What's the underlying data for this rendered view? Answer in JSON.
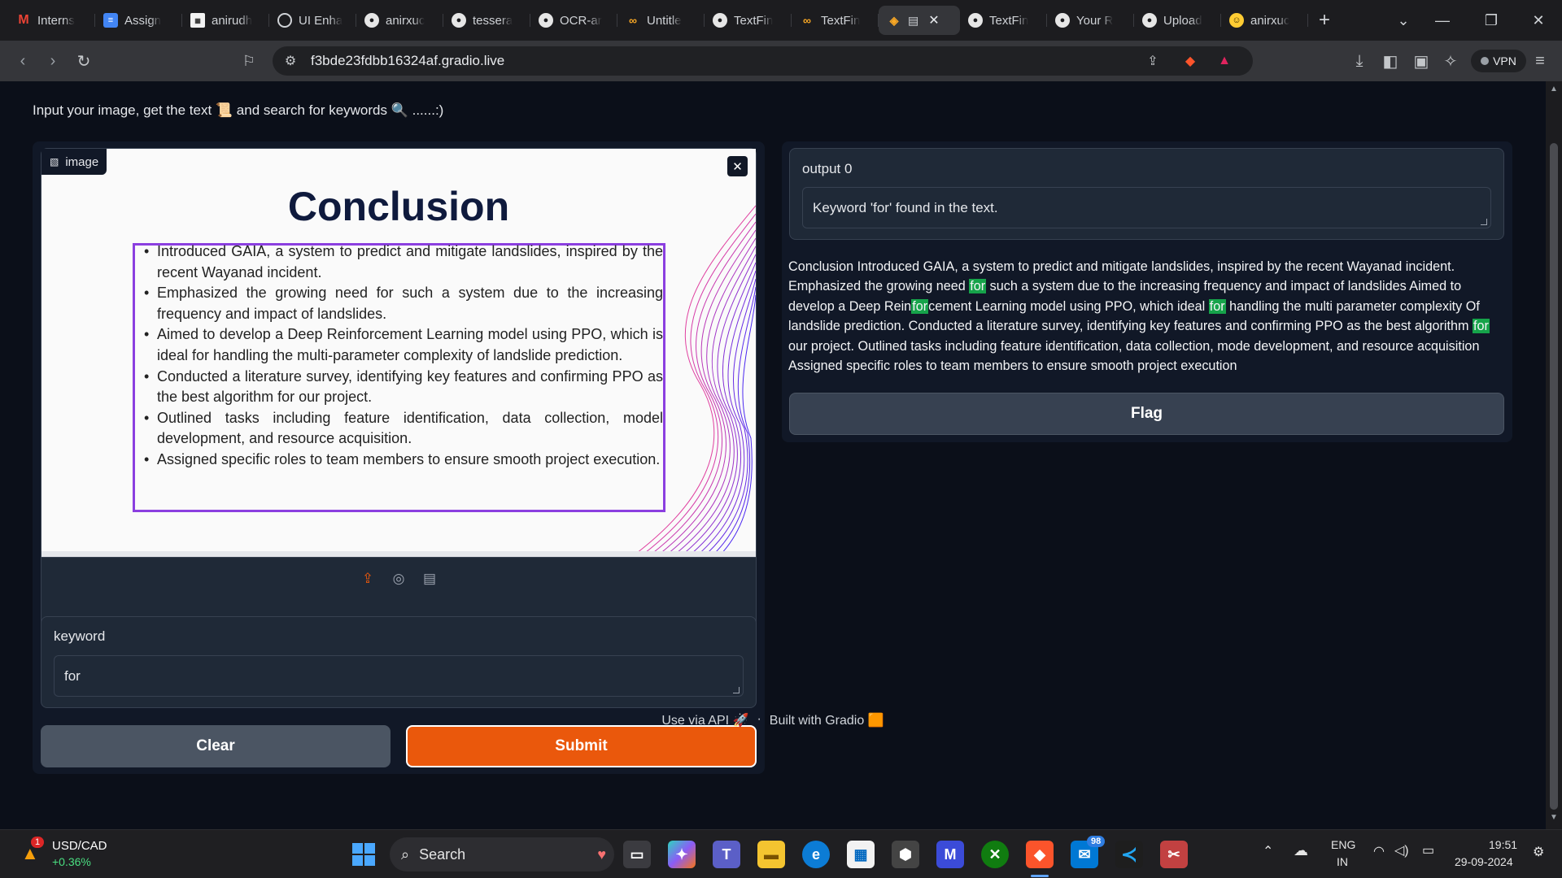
{
  "browser": {
    "tabs": [
      {
        "label": "Interns",
        "icon": "gmail-icon"
      },
      {
        "label": "Assign",
        "icon": "docs-icon"
      },
      {
        "label": "anirudh",
        "icon": "image-icon"
      },
      {
        "label": "UI Enha",
        "icon": "ai-icon"
      },
      {
        "label": "anirxuc",
        "icon": "github-icon"
      },
      {
        "label": "tessera",
        "icon": "github-icon"
      },
      {
        "label": "OCR-ar",
        "icon": "github-icon"
      },
      {
        "label": "Untitle",
        "icon": "colab-icon"
      },
      {
        "label": "TextFin",
        "icon": "github-icon"
      },
      {
        "label": "TextFin",
        "icon": "colab-icon"
      },
      {
        "label": "",
        "icon": "gradio-icon",
        "active": true
      },
      {
        "label": "TextFin",
        "icon": "github-icon"
      },
      {
        "label": "Your R",
        "icon": "github-icon"
      },
      {
        "label": "Upload",
        "icon": "github-icon"
      },
      {
        "label": "anirxuc",
        "icon": "huggingface-icon"
      }
    ],
    "url": "f3bde23fdbb16324af.gradio.live",
    "vpn_label": "VPN"
  },
  "app": {
    "description": "Input your image, get the text 📜 and search for keywords 🔍 ......:)",
    "image_label": "image",
    "slide": {
      "title": "Conclusion",
      "bullets": [
        "Introduced GAIA, a system to predict and mitigate landslides, inspired by the recent Wayanad incident.",
        "Emphasized the growing need for such a system due to the increasing frequency and impact of landslides.",
        "Aimed to develop a Deep Reinforcement Learning model using PPO, which is ideal for handling the multi-parameter complexity of landslide prediction.",
        "Conducted a literature survey, identifying key features and confirming PPO as the best algorithm for our project.",
        "Outlined tasks including feature identification, data collection, model development, and resource acquisition.",
        "Assigned specific roles to team members to ensure smooth project execution."
      ]
    },
    "keyword_label": "keyword",
    "keyword_value": "for",
    "clear_label": "Clear",
    "submit_label": "Submit",
    "output_label": "output 0",
    "output_value": "Keyword 'for' found in the text.",
    "result": {
      "t1": "Conclusion Introduced GAIA, a system to predict and mitigate landslides, inspired by the recent Wayanad incident. Emphasized the growing need ",
      "h1": "for",
      "t2": " such a system due to the increasing frequency and impact of landslides Aimed to develop a Deep Rein",
      "h2": "for",
      "t3": "cement Learning model using PPO, which ideal ",
      "h3": "for",
      "t4": " handling the multi parameter complexity Of landslide prediction. Conducted a literature survey, identifying key features and confirming PPO as the best algorithm ",
      "h4": "for",
      "t5": " our project. Outlined tasks including feature identification, data collection, mode development, and resource acquisition Assigned specific roles to team members to ensure smooth project execution"
    },
    "flag_label": "Flag",
    "footer_api": "Use via API 🚀",
    "footer_sep": "·",
    "footer_built": "Built with Gradio 🟧"
  },
  "taskbar": {
    "widget_ticker": "USD/CAD",
    "widget_change": "+0.36%",
    "widget_badge": "1",
    "search_label": "Search",
    "mail_badge": "98",
    "lang_top": "ENG",
    "lang_bottom": "IN",
    "time": "19:51",
    "date": "29-09-2024"
  },
  "colors": {
    "accent": "#ea580c",
    "highlight": "#16a34a",
    "slide_border": "#8b3fe0"
  }
}
